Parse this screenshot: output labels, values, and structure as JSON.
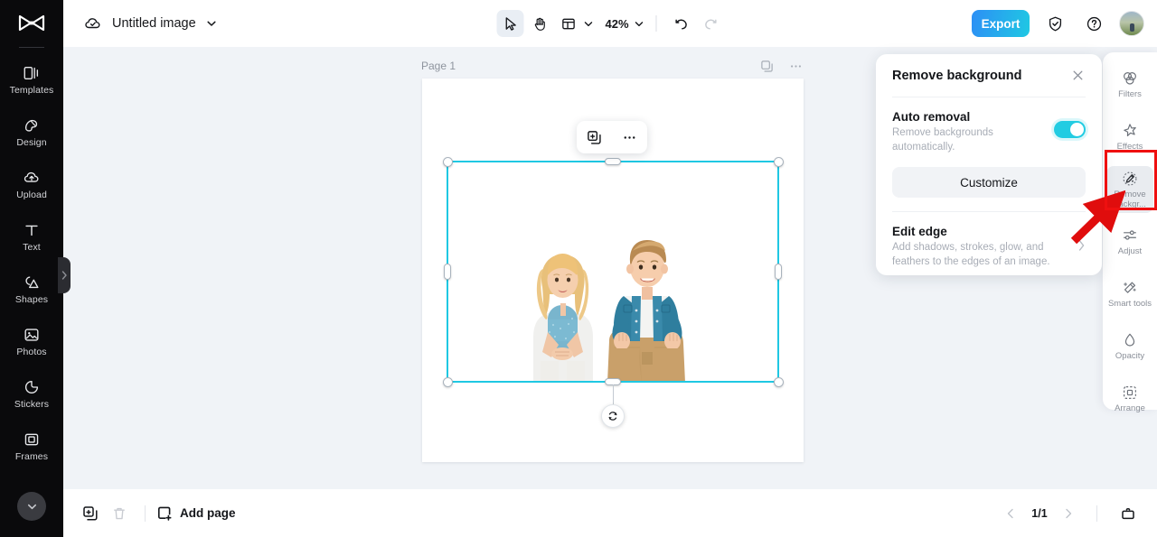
{
  "app": {
    "sidebar": {
      "logo": "capcut-logo",
      "items": [
        {
          "label": "Templates",
          "icon": "templates-icon"
        },
        {
          "label": "Design",
          "icon": "design-icon"
        },
        {
          "label": "Upload",
          "icon": "upload-cloud-icon"
        },
        {
          "label": "Text",
          "icon": "text-icon"
        },
        {
          "label": "Shapes",
          "icon": "shapes-icon"
        },
        {
          "label": "Photos",
          "icon": "photos-icon"
        },
        {
          "label": "Stickers",
          "icon": "stickers-icon"
        },
        {
          "label": "Frames",
          "icon": "frames-icon"
        }
      ],
      "collapse_handle": "collapse-chevron-icon",
      "scroll_down": "chevron-down-icon"
    },
    "topbar": {
      "cloud_icon": "cloud-saved-icon",
      "doc_title": "Untitled image",
      "title_caret": "chevron-down-icon",
      "tools": [
        {
          "name": "select-tool",
          "icon": "cursor-arrow-icon",
          "active": true
        },
        {
          "name": "hand-tool",
          "icon": "hand-icon",
          "active": false
        },
        {
          "name": "layout-tool",
          "icon": "layout-grid-icon",
          "active": false
        }
      ],
      "zoom_value": "42%",
      "undo": "undo-icon",
      "redo": "redo-icon",
      "export_label": "Export",
      "shield_icon": "shield-check-icon",
      "help_icon": "help-circle-icon",
      "avatar": "user-avatar"
    },
    "canvas": {
      "page_label": "Page 1",
      "page_duplicate_icon": "duplicate-icon",
      "page_more_icon": "more-horizontal-icon",
      "float_toolbar": {
        "duplicate_icon": "duplicate-add-icon",
        "more_icon": "more-horizontal-icon"
      },
      "selection": {
        "rotate_icon": "rotate-icon",
        "border_color": "#1fc8e3"
      },
      "image_alt": "two smiling children on white background"
    },
    "panel": {
      "title": "Remove background",
      "close_icon": "close-icon",
      "auto_removal": {
        "title": "Auto removal",
        "description": "Remove backgrounds automatically.",
        "toggle_on": true,
        "toggle_color": "#22cce2"
      },
      "customize_label": "Customize",
      "edit_edge": {
        "title": "Edit edge",
        "description": "Add shadows, strokes, glow, and feathers to the edges of an image.",
        "chevron": "chevron-right-icon"
      }
    },
    "tool_rail": {
      "items": [
        {
          "label": "Filters",
          "icon": "filters-icon",
          "selected": false
        },
        {
          "label": "Effects",
          "icon": "effects-icon",
          "selected": false
        },
        {
          "label": "Remove backgr...",
          "icon": "remove-background-icon",
          "selected": true
        },
        {
          "label": "Adjust",
          "icon": "adjust-sliders-icon",
          "selected": false
        },
        {
          "label": "Smart tools",
          "icon": "smart-tools-icon",
          "selected": false
        },
        {
          "label": "Opacity",
          "icon": "opacity-drop-icon",
          "selected": false
        },
        {
          "label": "Arrange",
          "icon": "arrange-icon",
          "selected": false
        }
      ]
    },
    "annotation": {
      "highlight_color": "#ef1010",
      "arrow_color": "#e00d0d",
      "target": "Remove backgr..."
    },
    "bottombar": {
      "duplicate_icon": "duplicate-icon",
      "delete_icon": "trash-icon",
      "add_page_label": "Add page",
      "add_page_icon": "add-page-icon",
      "prev_icon": "chevron-left-icon",
      "page_counter": "1/1",
      "next_icon": "chevron-right-icon",
      "grid_view_icon": "presentation-icon"
    }
  }
}
